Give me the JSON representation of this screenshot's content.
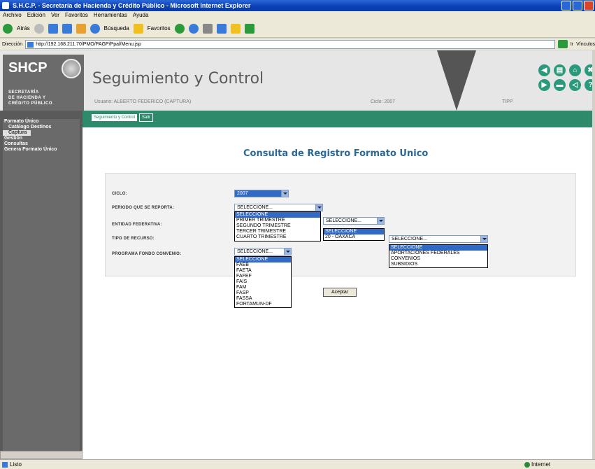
{
  "window": {
    "title": "S.H.C.P. - Secretaría de Hacienda y Crédito Público - Microsoft Internet Explorer"
  },
  "menubar": [
    "Archivo",
    "Edición",
    "Ver",
    "Favoritos",
    "Herramientas",
    "Ayuda"
  ],
  "toolbar": {
    "back": "Atrás",
    "search": "Búsqueda",
    "favorites": "Favoritos"
  },
  "addressbar": {
    "label": "Dirección",
    "url": "http://192.168.211.70/PMO/PAGP/Ppal/Menu.jsp",
    "go": "Ir",
    "links": "Vínculos"
  },
  "header": {
    "logo": "SHCP",
    "logo_subtext": "SECRETARÍA\nDE HACIENDA Y\nCRÉDITO PÚBLICO",
    "app_title": "Seguimiento y Control",
    "user": "Usuario: ALBERTO FEDERICO (CAPTURA)",
    "cycle": "Ciclo: 2007",
    "tipp": "TIPP",
    "nav_icons": [
      "◀",
      "▤",
      "⌂",
      "✖",
      "▶",
      "▬",
      "◁",
      "?"
    ]
  },
  "sidebar": {
    "items": [
      {
        "label": "Formato Único",
        "sub": false,
        "selected": false
      },
      {
        "label": "Catálogo Destinos",
        "sub": true,
        "selected": false
      },
      {
        "label": "Captura",
        "sub": true,
        "selected": true
      },
      {
        "label": "Gestión",
        "sub": false,
        "selected": false
      },
      {
        "label": "Consultas",
        "sub": false,
        "selected": false
      },
      {
        "label": "Genera Formato Único",
        "sub": false,
        "selected": false
      }
    ]
  },
  "tabs": [
    {
      "label": "Seguimiento y Control",
      "active": false
    },
    {
      "label": "Salir",
      "active": true
    }
  ],
  "page": {
    "title": "Consulta de Registro Formato Unico"
  },
  "form": {
    "labels": {
      "ciclo": "CICLO:",
      "periodo": "PERIODO QUE SE REPORTA:",
      "entidad": "ENTIDAD FEDERATIVA:",
      "tipo": "TIPO DE RECURSO:",
      "programa": "PROGRAMA FONDO CONVENIO:"
    },
    "ciclo_value": "2007",
    "periodo_value": "SELECCIONE...",
    "periodo_options": [
      "SELECCIONE",
      "PRIMER TRIMESTRE",
      "SEGUNDO TRIMESTRE",
      "TERCER TRIMESTRE",
      "CUARTO TRIMESTRE"
    ],
    "entidad_value": "SELECCIONE...",
    "entidad_options": [
      "SELECCIONE",
      "20 - OAXACA"
    ],
    "tipo_value": "SELECCIONE...",
    "tipo_options": [
      "SELECCIONE",
      "APORTACIONES FEDERALES",
      "CONVENIOS",
      "SUBSIDIOS"
    ],
    "programa_value": "SELECCIONE...",
    "programa_options": [
      "SELECCIONE",
      "FAEB",
      "FAETA",
      "FAFEF",
      "FAIS",
      "FAM",
      "FASP",
      "FASSA",
      "FORTAMUN-DF"
    ],
    "accept_button": "Aceptar"
  },
  "statusbar": {
    "text": "Listo",
    "zone": "Internet"
  }
}
